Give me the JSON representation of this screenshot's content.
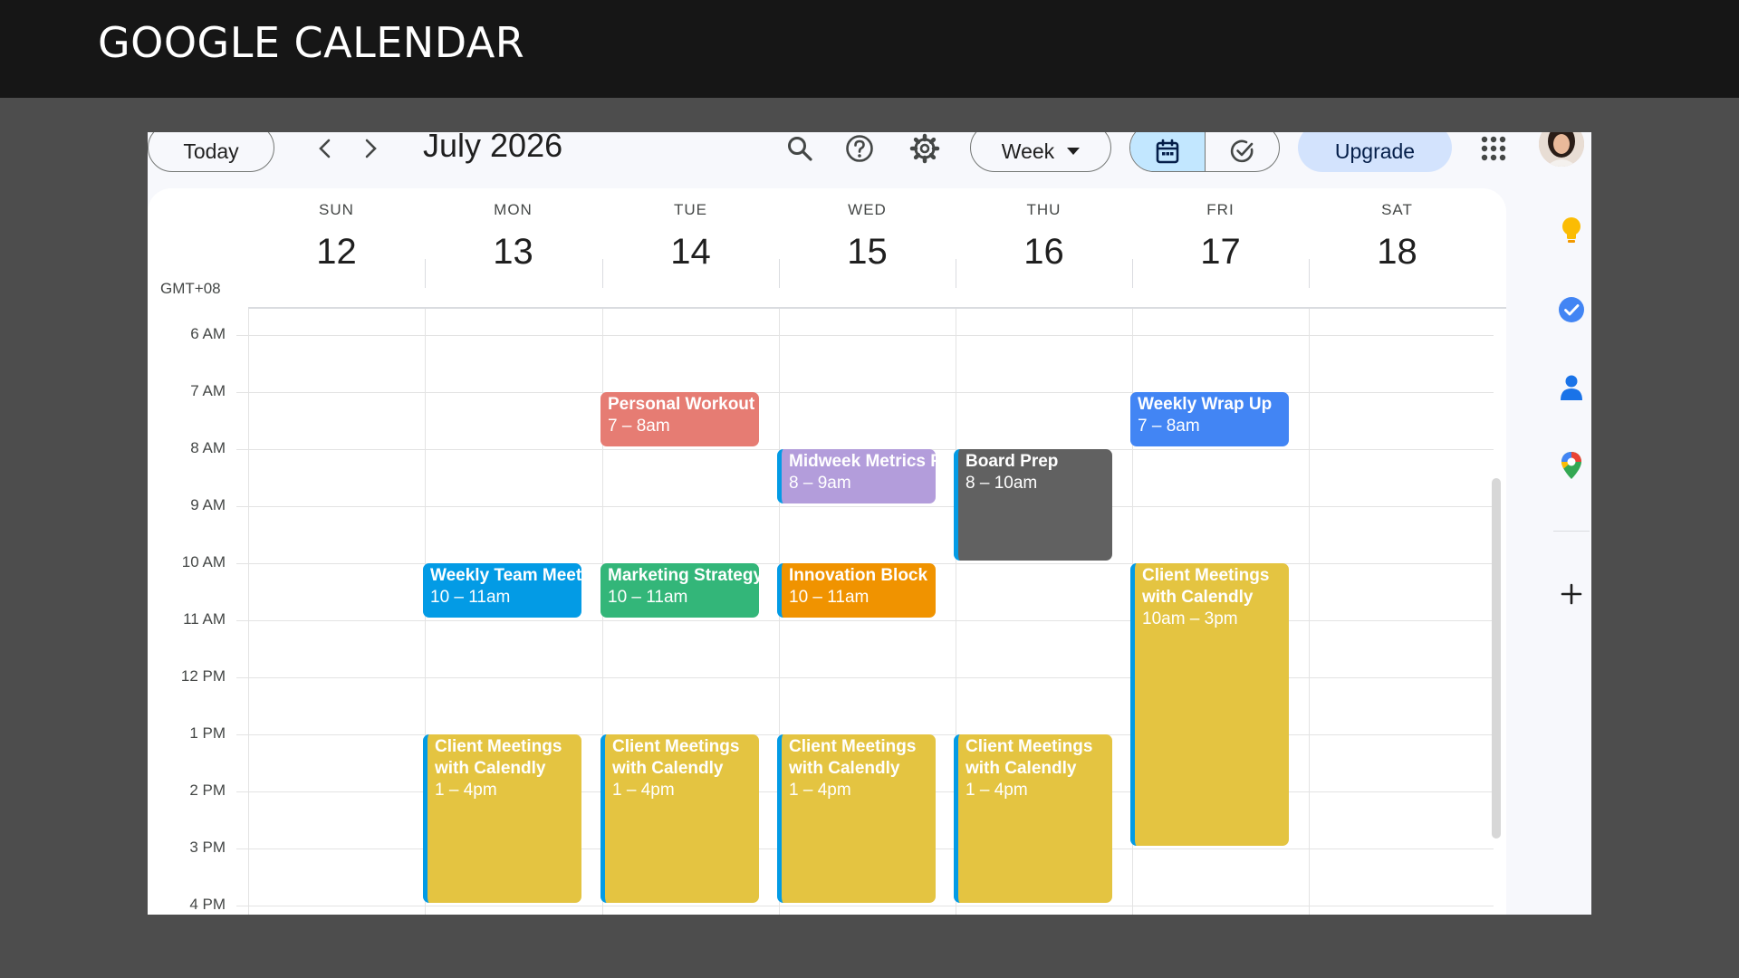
{
  "slide": {
    "title": "GOOGLE CALENDAR"
  },
  "toolbar": {
    "today_label": "Today",
    "month_title": "July 2026",
    "view_label": "Week",
    "upgrade_label": "Upgrade"
  },
  "calendar": {
    "timezone": "GMT+08",
    "days": [
      {
        "name": "SUN",
        "num": "12"
      },
      {
        "name": "MON",
        "num": "13"
      },
      {
        "name": "TUE",
        "num": "14"
      },
      {
        "name": "WED",
        "num": "15"
      },
      {
        "name": "THU",
        "num": "16"
      },
      {
        "name": "FRI",
        "num": "17"
      },
      {
        "name": "SAT",
        "num": "18"
      }
    ],
    "hours": [
      "6 AM",
      "7 AM",
      "8 AM",
      "9 AM",
      "10 AM",
      "11 AM",
      "12 PM",
      "1 PM",
      "2 PM",
      "3 PM",
      "4 PM"
    ],
    "events": [
      {
        "title": "Personal Workout",
        "time": "7 – 8am",
        "color": "#e67c73"
      },
      {
        "title": "Weekly Wrap Up",
        "time": "7 – 8am",
        "color": "#4285f4"
      },
      {
        "title": "Midweek Metrics R",
        "time": "8 – 9am",
        "color": "#b39ddb"
      },
      {
        "title": "Board Prep",
        "time": "8 – 10am",
        "color": "#616161"
      },
      {
        "title": "Weekly Team Meet",
        "time": "10 – 11am",
        "color": "#039be5"
      },
      {
        "title": "Marketing Strategy",
        "time": "10 – 11am",
        "color": "#33b679"
      },
      {
        "title": "Innovation Block",
        "time": "10 – 11am",
        "color": "#f09300"
      },
      {
        "title": "Client Meetings with Calendly",
        "time": "10am – 3pm",
        "color": "#e4c441"
      },
      {
        "title": "Client Meetings with Calendly",
        "time": "1 – 4pm",
        "color": "#e4c441"
      },
      {
        "title": "Client Meetings with Calendly",
        "time": "1 – 4pm",
        "color": "#e4c441"
      },
      {
        "title": "Client Meetings with Calendly",
        "time": "1 – 4pm",
        "color": "#e4c441"
      },
      {
        "title": "Client Meetings with Calendly",
        "time": "1 – 4pm",
        "color": "#e4c441"
      }
    ]
  },
  "side_panel": {
    "icons": [
      "keep-icon",
      "tasks-icon",
      "contacts-icon",
      "maps-icon",
      "add-icon"
    ]
  }
}
